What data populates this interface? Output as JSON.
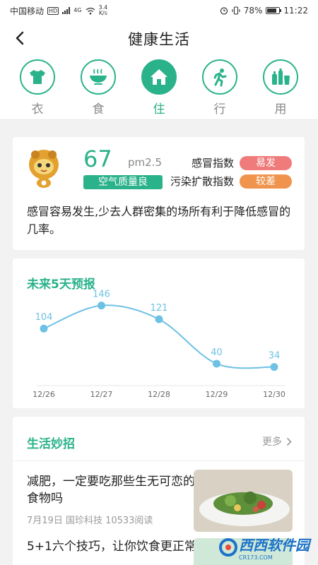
{
  "status_bar": {
    "carrier": "中国移动",
    "hd": "HD",
    "net_type": "4G",
    "speed_value": "3.4",
    "speed_unit": "K/s",
    "battery": "78%",
    "time": "11:22"
  },
  "header": {
    "title": "健康生活"
  },
  "tabs": [
    {
      "label": "衣",
      "icon": "tshirt-icon",
      "active": false
    },
    {
      "label": "食",
      "icon": "bowl-icon",
      "active": false
    },
    {
      "label": "住",
      "icon": "house-icon",
      "active": true
    },
    {
      "label": "行",
      "icon": "running-icon",
      "active": false
    },
    {
      "label": "用",
      "icon": "bottles-icon",
      "active": false
    }
  ],
  "aqi": {
    "value": "67",
    "unit": "pm2.5",
    "level": "空气质量良",
    "indices": [
      {
        "name": "感冒指数",
        "value": "易发",
        "color": "#f07b7b"
      },
      {
        "name": "污染扩散指数",
        "value": "较差",
        "color": "#f0944d"
      }
    ],
    "description": "感冒容易发生,少去人群密集的场所有利于降低感冒的几率。"
  },
  "forecast": {
    "title": "未来5天预报"
  },
  "chart_data": {
    "type": "line",
    "title": "未来5天预报",
    "categories": [
      "12/26",
      "12/27",
      "12/28",
      "12/29",
      "12/30"
    ],
    "values": [
      104,
      146,
      121,
      40,
      34
    ],
    "ylim": [
      0,
      170
    ],
    "color": "#6ec1e4",
    "grid": false
  },
  "tips": {
    "title": "生活妙招",
    "more": "更多",
    "articles": [
      {
        "title": "减肥，一定要吃那些生无可恋的食物吗",
        "meta": "7月19日 国珍科技 10533阅读"
      },
      {
        "title": "5+1六个技巧，让你饮食更正常"
      }
    ]
  },
  "watermark": {
    "text": "西西软件园",
    "sub": "CR173.COM"
  }
}
